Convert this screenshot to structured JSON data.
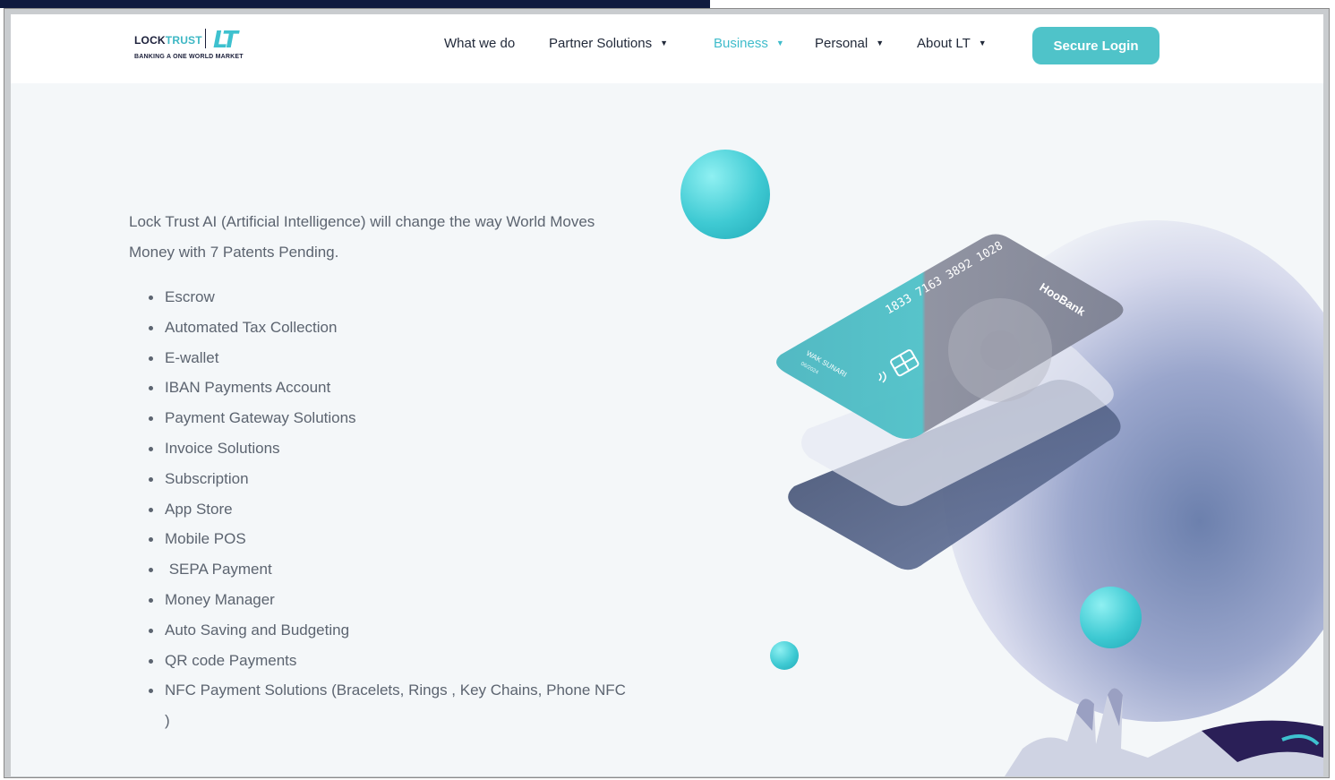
{
  "brand": {
    "name_part1": "LOCK",
    "name_part2": "TRUST",
    "mark": "LT",
    "tagline": "BANKING A ONE WORLD MARKET"
  },
  "nav": {
    "items": [
      {
        "label": "What we do",
        "has_dropdown": false,
        "active": false
      },
      {
        "label": "Partner Solutions",
        "has_dropdown": true,
        "active": false
      },
      {
        "label": "Business",
        "has_dropdown": true,
        "active": true
      },
      {
        "label": "Personal",
        "has_dropdown": true,
        "active": false
      },
      {
        "label": "About LT",
        "has_dropdown": true,
        "active": false
      }
    ],
    "login_label": "Secure Login"
  },
  "hero": {
    "intro": "Lock Trust AI (Artificial Intelligence) will change the way World Moves Money with 7 Patents Pending.",
    "features": [
      "Escrow",
      "Automated Tax Collection",
      "E-wallet",
      "IBAN Payments Account",
      "Payment Gateway Solutions",
      "Invoice Solutions",
      "Subscription",
      "App Store",
      "Mobile POS",
      " SEPA Payment",
      "Money Manager",
      "Auto Saving and Budgeting",
      "QR code Payments",
      "NFC Payment Solutions (Bracelets, Rings , Key Chains, Phone NFC )"
    ]
  },
  "card": {
    "number": "1833 7163 3892 1028",
    "brand": "HooBank",
    "holder": "WAK SUNARI",
    "expiry": "06/2024"
  },
  "colors": {
    "accent": "#3fbccb",
    "login_bg": "#4fc3c9",
    "text": "#5c6470",
    "nav_text": "#222a3a",
    "logo_dark": "#1b1f3a"
  },
  "icons": [
    "caret-down-icon",
    "nfc-contactless-icon",
    "card-chip-icon",
    "hoobank-logo-icon"
  ]
}
